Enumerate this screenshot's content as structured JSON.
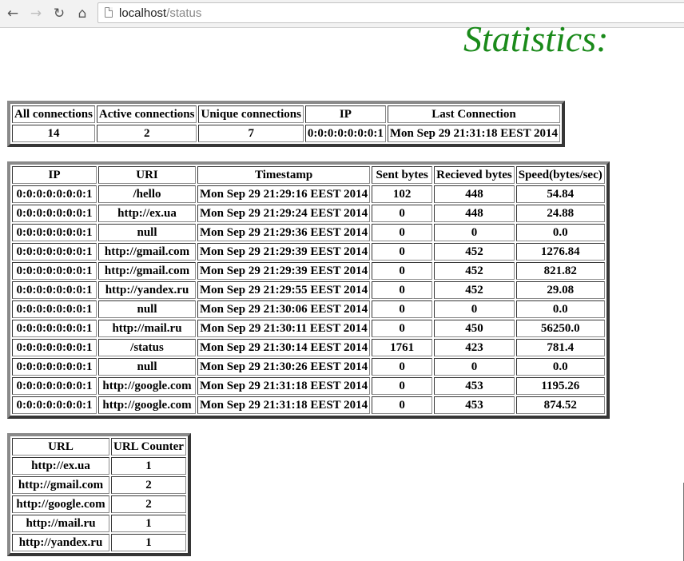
{
  "browser": {
    "url_host": "localhost",
    "url_path": "/status",
    "icons": [
      "back-arrow-icon",
      "forward-arrow-icon",
      "reload-icon",
      "home-icon",
      "page-icon"
    ]
  },
  "page_title": "Statistics:",
  "summary": {
    "headers": [
      "All connections",
      "Active connections",
      "Unique connections",
      "IP",
      "Last Connection"
    ],
    "values": [
      "14",
      "2",
      "7",
      "0:0:0:0:0:0:0:1",
      "Mon Sep 29 21:31:18 EEST 2014"
    ]
  },
  "connections": {
    "headers": [
      "IP",
      "URI",
      "Timestamp",
      "Sent bytes",
      "Recieved bytes",
      "Speed(bytes/sec)"
    ],
    "rows": [
      [
        "0:0:0:0:0:0:0:1",
        "/hello",
        "Mon Sep 29 21:29:16 EEST 2014",
        "102",
        "448",
        "54.84"
      ],
      [
        "0:0:0:0:0:0:0:1",
        "http://ex.ua",
        "Mon Sep 29 21:29:24 EEST 2014",
        "0",
        "448",
        "24.88"
      ],
      [
        "0:0:0:0:0:0:0:1",
        "null",
        "Mon Sep 29 21:29:36 EEST 2014",
        "0",
        "0",
        "0.0"
      ],
      [
        "0:0:0:0:0:0:0:1",
        "http://gmail.com",
        "Mon Sep 29 21:29:39 EEST 2014",
        "0",
        "452",
        "1276.84"
      ],
      [
        "0:0:0:0:0:0:0:1",
        "http://gmail.com",
        "Mon Sep 29 21:29:39 EEST 2014",
        "0",
        "452",
        "821.82"
      ],
      [
        "0:0:0:0:0:0:0:1",
        "http://yandex.ru",
        "Mon Sep 29 21:29:55 EEST 2014",
        "0",
        "452",
        "29.08"
      ],
      [
        "0:0:0:0:0:0:0:1",
        "null",
        "Mon Sep 29 21:30:06 EEST 2014",
        "0",
        "0",
        "0.0"
      ],
      [
        "0:0:0:0:0:0:0:1",
        "http://mail.ru",
        "Mon Sep 29 21:30:11 EEST 2014",
        "0",
        "450",
        "56250.0"
      ],
      [
        "0:0:0:0:0:0:0:1",
        "/status",
        "Mon Sep 29 21:30:14 EEST 2014",
        "1761",
        "423",
        "781.4"
      ],
      [
        "0:0:0:0:0:0:0:1",
        "null",
        "Mon Sep 29 21:30:26 EEST 2014",
        "0",
        "0",
        "0.0"
      ],
      [
        "0:0:0:0:0:0:0:1",
        "http://google.com",
        "Mon Sep 29 21:31:18 EEST 2014",
        "0",
        "453",
        "1195.26"
      ],
      [
        "0:0:0:0:0:0:0:1",
        "http://google.com",
        "Mon Sep 29 21:31:18 EEST 2014",
        "0",
        "453",
        "874.52"
      ]
    ]
  },
  "url_counter": {
    "headers": [
      "URL",
      "URL Counter"
    ],
    "rows": [
      [
        "http://ex.ua",
        "1"
      ],
      [
        "http://gmail.com",
        "2"
      ],
      [
        "http://google.com",
        "2"
      ],
      [
        "http://mail.ru",
        "1"
      ],
      [
        "http://yandex.ru",
        "1"
      ]
    ]
  },
  "colors": {
    "title": "#1a8a1a",
    "table_border": "#8a8a8a",
    "toolbar_bg": "#f2f2f2"
  }
}
